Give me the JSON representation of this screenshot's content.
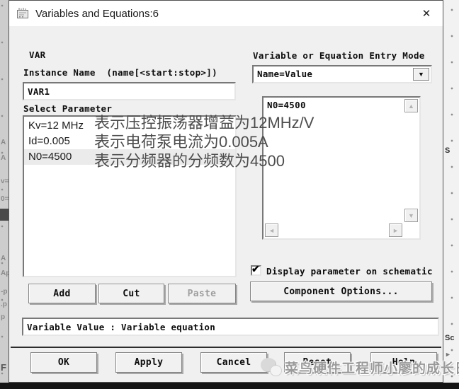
{
  "window": {
    "title": "Variables and Equations:6"
  },
  "icons": {
    "close": "✕",
    "dropdown": "▼",
    "scroll_up": "▲",
    "scroll_down": "▼",
    "scroll_left": "◄",
    "scroll_right": "►",
    "check": "✔"
  },
  "left_panel": {
    "var_label": "VAR",
    "instance_name_label": "Instance Name  (name[<start:stop>])",
    "instance_name_value": "VAR1",
    "select_parameter_label": "Select Parameter",
    "parameters": [
      {
        "label": "Kv=12 MHz",
        "selected": false
      },
      {
        "label": "Id=0.005",
        "selected": false
      },
      {
        "label": "N0=4500",
        "selected": true
      }
    ],
    "add_button": "Add",
    "cut_button": "Cut",
    "paste_button": "Paste"
  },
  "right_panel": {
    "entry_mode_label": "Variable or Equation Entry Mode",
    "entry_mode_value": "Name=Value",
    "editor_text": "N0=4500",
    "display_checkbox_label": "Display parameter on schematic",
    "display_checkbox_checked": true,
    "component_options_button": "Component Options..."
  },
  "annotations": [
    "表示压控振荡器增益为12MHz/V",
    "表示电荷泵电流为0.005A",
    "表示分频器的分频数为4500"
  ],
  "variable_value_field": "Variable Value : Variable equation",
  "footer_buttons": [
    "OK",
    "Apply",
    "Cancel",
    "Reset",
    "Help"
  ],
  "watermark": "菜鸟硬件工程师小廖的成长日记",
  "edges": {
    "left_fragments": [
      "A",
      "A",
      "v=",
      "0=",
      "A",
      "Ap",
      "-p",
      ".p",
      "p",
      "F"
    ],
    "right_fragments": [
      "S",
      "Sc"
    ]
  },
  "colors": {
    "dialog_bg": "#f0f0f0",
    "titlebar_bg": "#ffffff",
    "selected_row_bg": "#ebebeb",
    "annotation_text": "#4d4d4d",
    "watermark_text": "#9a9a9a",
    "disabled_text": "#9e9e9e",
    "bottom_bar": "#141414"
  }
}
